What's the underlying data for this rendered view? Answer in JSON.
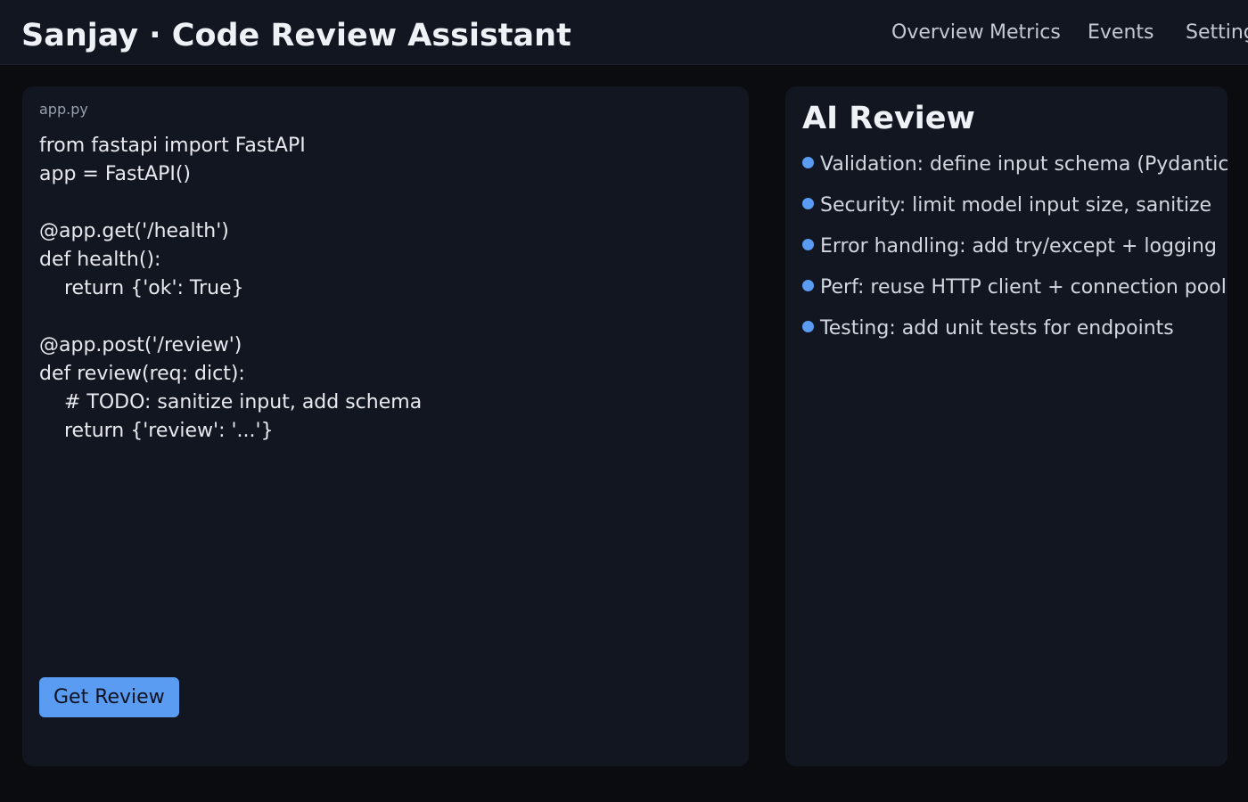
{
  "header": {
    "title": "Sanjay · Code Review Assistant",
    "nav": [
      "Overview",
      "Metrics",
      "Events",
      "Settings"
    ]
  },
  "editor": {
    "filename": "app.py",
    "code": "from fastapi import FastAPI\napp = FastAPI()\n\n@app.get('/health')\ndef health():\n    return {'ok': True}\n\n@app.post('/review')\ndef review(req: dict):\n    # TODO: sanitize input, add schema\n    return {'review': '...'}",
    "button_label": "Get Review"
  },
  "review": {
    "title": "AI Review",
    "items": [
      "Validation: define input schema (Pydantic)",
      "Security: limit model input size, sanitize",
      "Error handling: add try/except + logging",
      "Perf: reuse HTTP client + connection pool",
      "Testing: add unit tests for endpoints"
    ]
  },
  "colors": {
    "accent": "#5b9cf3",
    "background": "#0b0c0f",
    "panel": "#121620"
  }
}
